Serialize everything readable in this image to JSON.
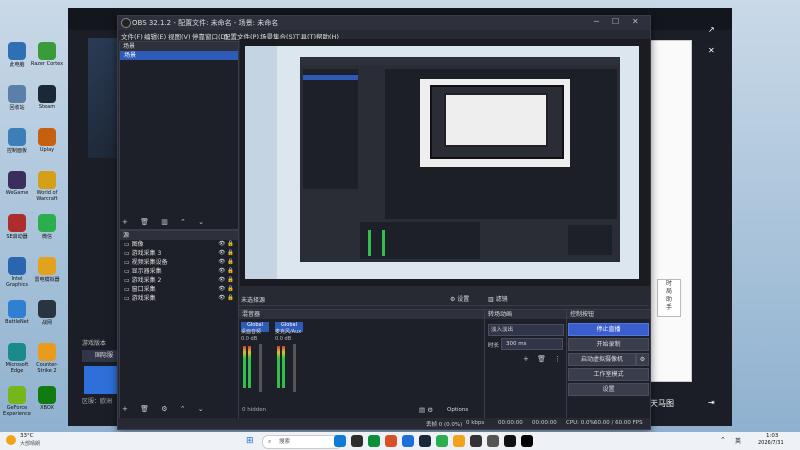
{
  "desktop": {
    "icons": [
      {
        "label": "此电脑",
        "color": "#2f6fb3"
      },
      {
        "label": "Razer Cortex",
        "color": "#3a9b3a"
      },
      {
        "label": "回收站",
        "color": "#5a7fa8"
      },
      {
        "label": "Steam",
        "color": "#1b2838"
      },
      {
        "label": "控制面板",
        "color": "#3c7fb8"
      },
      {
        "label": "Uplay",
        "color": "#c56010"
      },
      {
        "label": "WeGame",
        "color": "#3a2e5c"
      },
      {
        "label": "World of Warcraft",
        "color": "#d4a017"
      },
      {
        "label": "SE启动器",
        "color": "#ad2d2d"
      },
      {
        "label": "微信",
        "color": "#2aae4e"
      },
      {
        "label": "Intel Graphics",
        "color": "#2a65b0"
      },
      {
        "label": "雷电模拟器",
        "color": "#e3a21c"
      },
      {
        "label": "BattleNet",
        "color": "#2f80d1"
      },
      {
        "label": "战网",
        "color": "#2a3340"
      },
      {
        "label": "Microsoft Edge",
        "color": "#1a8a8a"
      },
      {
        "label": "Counter-Strike 2",
        "color": "#e89b1c"
      },
      {
        "label": "GeForce Experience",
        "color": "#74b71b"
      },
      {
        "label": "XBOX",
        "color": "#107c10"
      }
    ]
  },
  "obs": {
    "title": "OBS 32.1.2 - 配置文件: 未命名 - 场景: 未命名",
    "menu": [
      "文件(F)",
      "编辑(E)",
      "视图(V)",
      "停靠窗口(D)",
      "配置文件(P)",
      "场景集合(S)",
      "工具(T)",
      "帮助(H)"
    ],
    "scenes": {
      "header": "场景",
      "items": [
        "场景"
      ]
    },
    "sources": {
      "header": "源",
      "items": [
        "图像",
        "游戏采集 3",
        "视频采集设备",
        "显示器采集",
        "游戏采集 2",
        "窗口采集",
        "游戏采集"
      ]
    },
    "selected_source_bar": {
      "label": "未选择源",
      "properties": "设置",
      "filters": "滤镜"
    },
    "mixer": {
      "header": "混音器",
      "channels": [
        {
          "tag": "Global",
          "name": "桌面音频",
          "level": "0.0 dB"
        },
        {
          "tag": "Global",
          "name": "麦克风/Aux",
          "level": "0.0 dB"
        }
      ],
      "hidden": "0 hidden",
      "options": "Options"
    },
    "transitions": {
      "header": "转场动画",
      "selected": "淡入淡出",
      "duration_label": "时长",
      "duration_value": "300 ms"
    },
    "controls": {
      "header": "控制按钮",
      "buttons": [
        "停止直播",
        "开始录制",
        "启动虚拟摄像机",
        "工作室模式",
        "设置"
      ]
    },
    "status": {
      "dropped": "丢帧 0 (0.0%)",
      "kbps": "0 kbps",
      "stream_time": "00:00:00",
      "rec_time": "00:00:00",
      "cpu": "CPU: 0.0%",
      "fps": "60.00 / 60.00 FPS"
    }
  },
  "bg_app": {
    "sidebar_label": "游戏版本",
    "btn_label": "国际服",
    "bottom_label": "区服：欧洲",
    "bottom_right": "天马图",
    "side_text": [
      "时",
      "局",
      "助",
      "手"
    ]
  },
  "taskbar": {
    "weather_temp": "33°C",
    "weather_desc": "大部晴朗",
    "search_placeholder": "搜索",
    "time": "1:03",
    "date": "2026/7/31",
    "lang": "英"
  }
}
